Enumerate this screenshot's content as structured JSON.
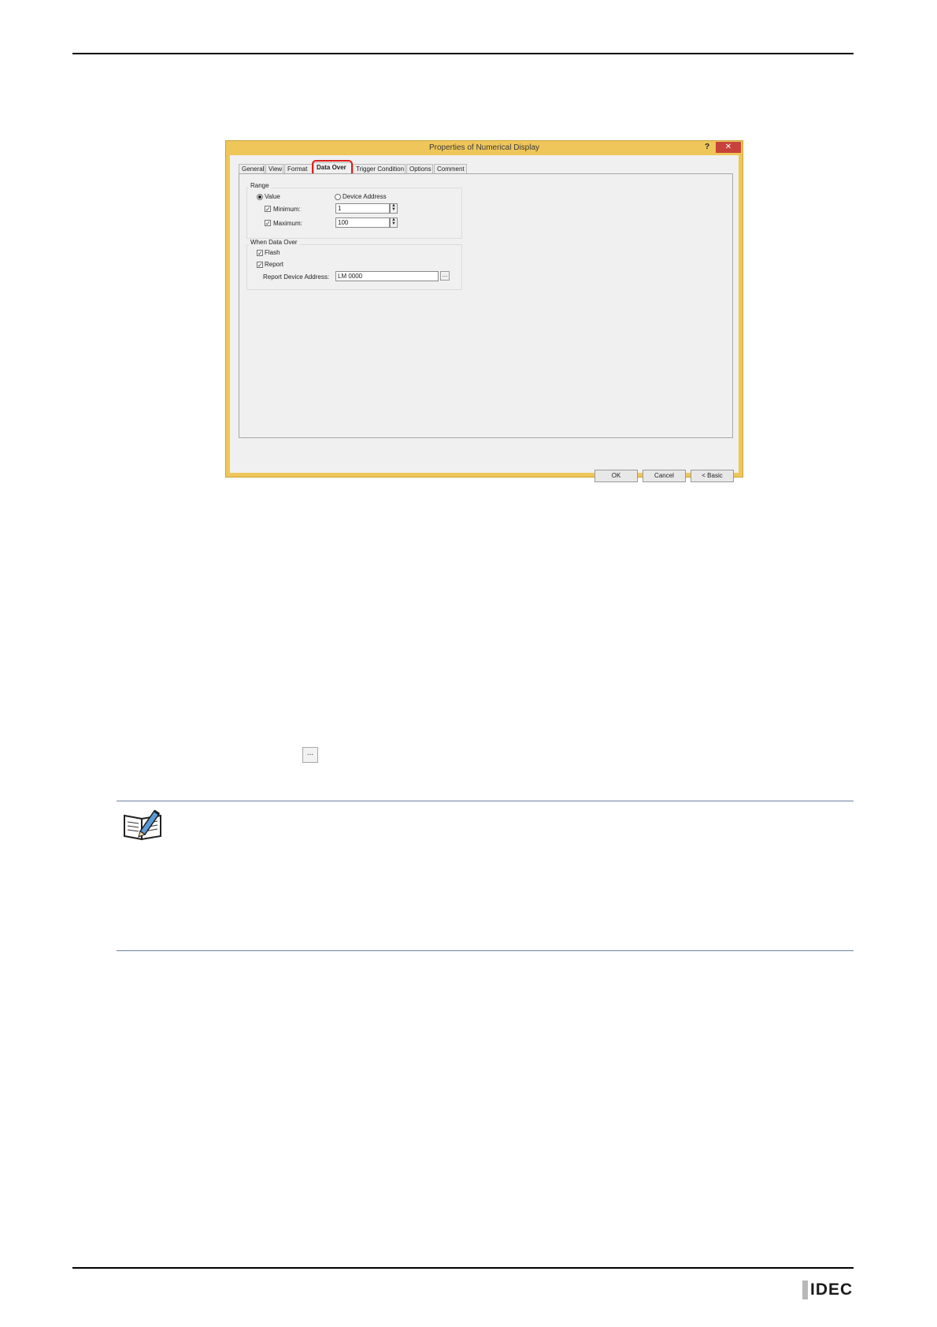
{
  "dialog": {
    "title": "Properties of Numerical Display",
    "help_label": "?",
    "close_label": "✕",
    "tabs": [
      "General",
      "View",
      "Format",
      "Data Over",
      "Trigger Condition",
      "Options",
      "Comment"
    ],
    "active_tab": "Data Over",
    "range": {
      "group_label": "Range",
      "value_label": "Value",
      "device_address_label": "Device Address",
      "minimum_label": "Minimum:",
      "minimum_value": "1",
      "maximum_label": "Maximum:",
      "maximum_value": "100"
    },
    "when_data_over": {
      "group_label": "When Data Over",
      "flash_label": "Flash",
      "report_label": "Report",
      "report_address_label": "Report Device Address:",
      "report_address_value": "LM 0000",
      "browse_label": "..."
    },
    "buttons": {
      "ok": "OK",
      "cancel": "Cancel",
      "basic": "< Basic"
    }
  },
  "page": {
    "browse_icon_label": "...",
    "logo_text": "IDEC"
  }
}
